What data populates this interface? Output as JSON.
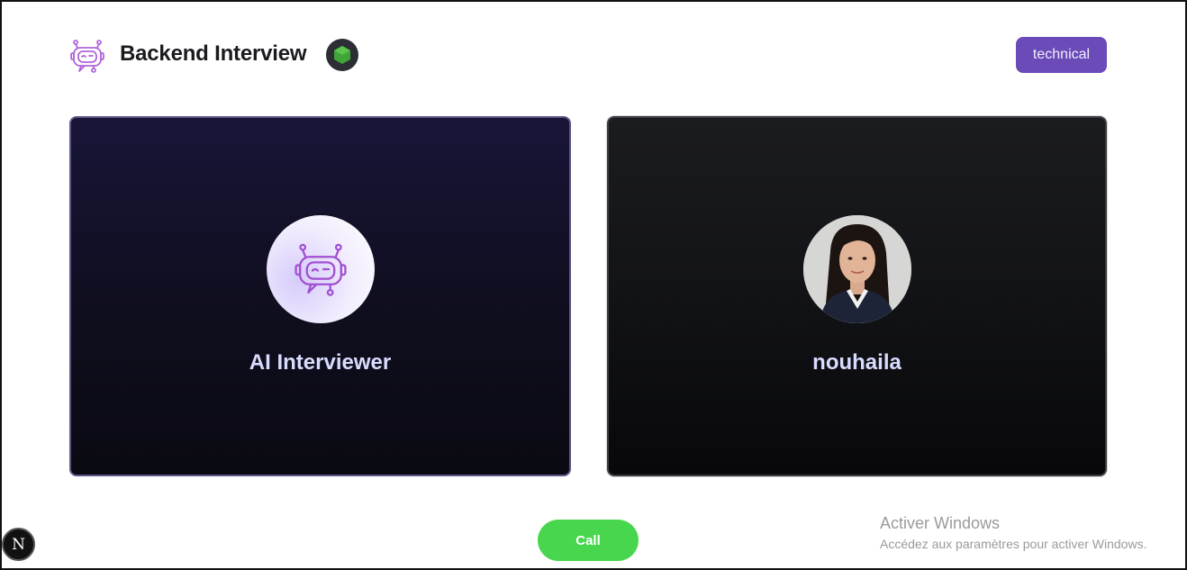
{
  "header": {
    "title": "Backend Interview",
    "logo_icon": "robot-chat-icon",
    "tech_icon": "nodejs-icon",
    "type_badge": "technical"
  },
  "panels": {
    "interviewer": {
      "name": "AI Interviewer",
      "icon": "robot-chat-icon"
    },
    "candidate": {
      "name": "nouhaila",
      "avatar": "user-photo"
    }
  },
  "actions": {
    "call_label": "Call"
  },
  "watermark": {
    "title": "Activer Windows",
    "subtitle": "Accédez aux paramètres pour activer Windows."
  },
  "dev_badge": {
    "label": "N"
  },
  "colors": {
    "accent": "#6a4bb8",
    "call_green": "#49d64f",
    "name_text": "#d9dcff",
    "robot_purple": "#9c4fd6"
  }
}
